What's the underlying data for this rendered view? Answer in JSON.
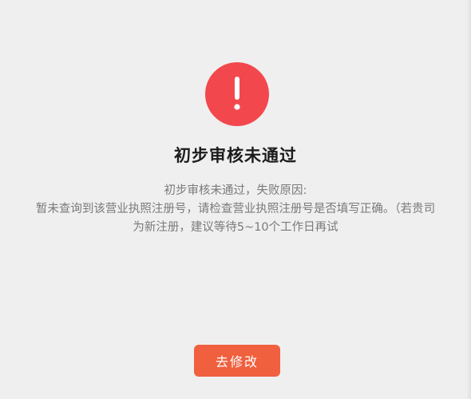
{
  "status": {
    "icon": "exclamation-icon",
    "icon_color": "#f2484d",
    "title": "初步审核未通过"
  },
  "message": {
    "line1": "初步审核未通过，失败原因:",
    "line2": "暂未查询到该营业执照注册号，请检查营业执照注册号是否填写正确。（若贵司",
    "line3": "为新注册，建议等待5~10个工作日再试"
  },
  "actions": {
    "modify_label": "去修改",
    "modify_color": "#f0603f"
  }
}
